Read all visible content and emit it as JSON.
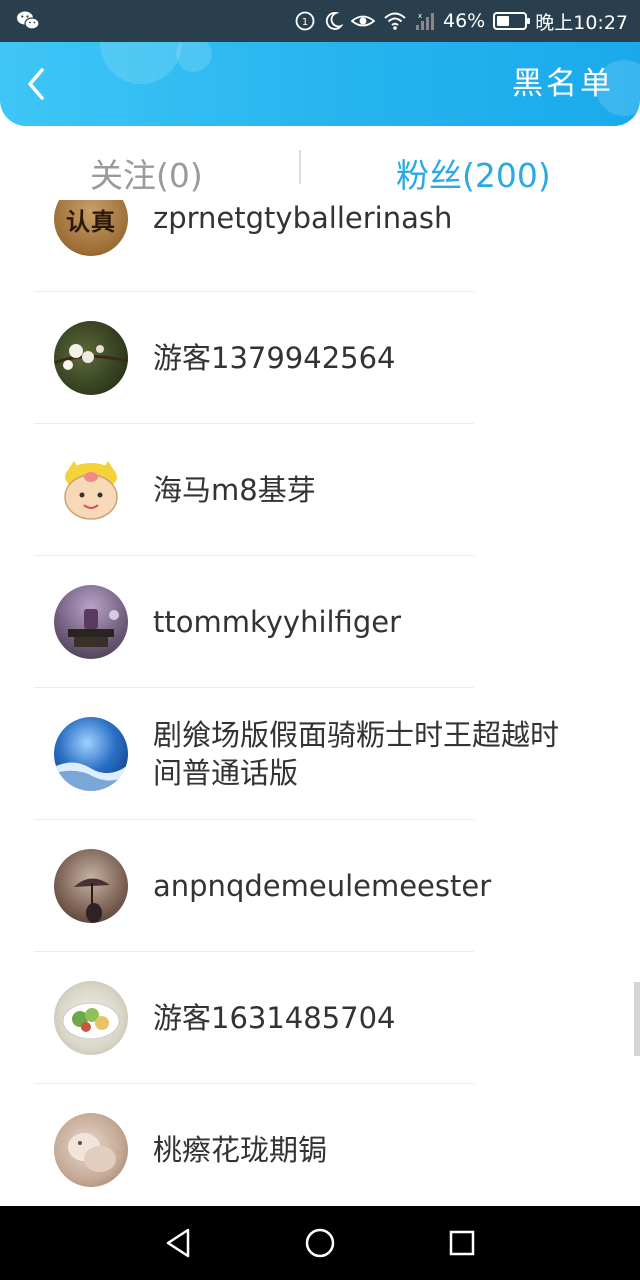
{
  "status_bar": {
    "battery_percent": "46%",
    "battery_level": 0.46,
    "time": "晚上10:27",
    "icons": [
      "wechat-icon",
      "hd-icon",
      "moon-icon",
      "eye-icon",
      "wifi-icon",
      "signal-icon",
      "battery-icon"
    ]
  },
  "header": {
    "back_icon": "chevron-left-icon",
    "right_action": "黑名单",
    "accent_color": "#2aa9e6"
  },
  "tabs": [
    {
      "label": "关注(0)",
      "active": false
    },
    {
      "label": "粉丝(200)",
      "active": true
    }
  ],
  "fans": [
    {
      "name": "zprnetgtyballerinash",
      "avatar_text": "认真"
    },
    {
      "name": "游客1379942564"
    },
    {
      "name": "海马m8基芽"
    },
    {
      "name": "ttommkyyhilfiger"
    },
    {
      "name": "剧飨场版假面骑粝士时王超越时间普通话版"
    },
    {
      "name": "anpnqdemeulemeester"
    },
    {
      "name": "游客1631485704"
    },
    {
      "name": "桃瘵花珑期锔"
    }
  ],
  "nav_bar": {
    "icons": [
      "back-triangle-icon",
      "home-circle-icon",
      "recents-square-icon"
    ]
  }
}
